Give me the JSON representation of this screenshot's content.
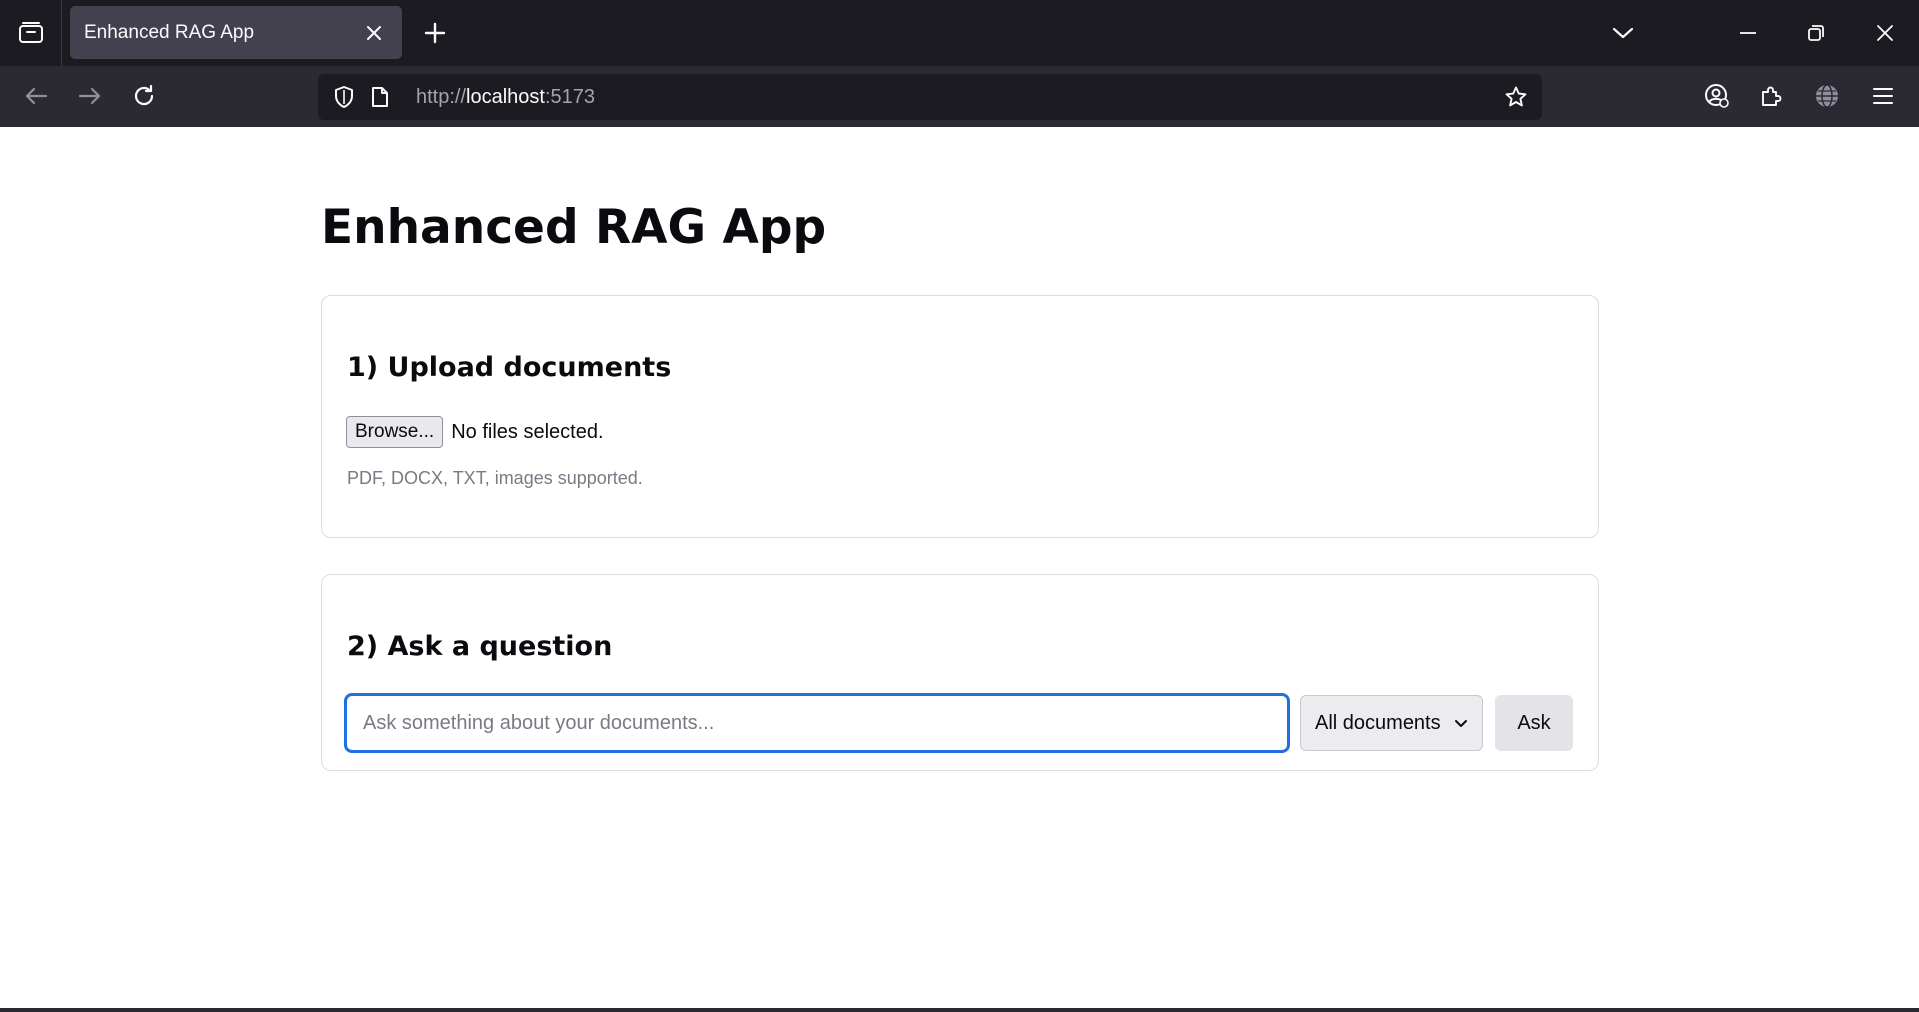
{
  "browser": {
    "tab_title": "Enhanced RAG App",
    "url_scheme": "http://",
    "url_host": "localhost",
    "url_port": ":5173",
    "icons": {
      "tab_overview": "tab-overview-icon",
      "tab_close": "close-icon",
      "new_tab": "plus-icon",
      "tab_list": "chevron-down-icon",
      "minimize": "minimize-icon",
      "restore": "restore-icon",
      "close_window": "close-icon",
      "back": "back-arrow-icon",
      "forward": "forward-arrow-icon",
      "reload": "reload-icon",
      "shield": "shield-icon",
      "page": "page-icon",
      "bookmark": "star-icon",
      "account": "account-icon",
      "extensions": "puzzle-icon",
      "translate": "globe-icon",
      "menu": "hamburger-menu-icon"
    }
  },
  "page": {
    "title": "Enhanced RAG App",
    "upload": {
      "heading": "1) Upload documents",
      "browse_label": "Browse...",
      "file_status": "No files selected.",
      "hint": "PDF, DOCX, TXT, images supported."
    },
    "ask": {
      "heading": "2) Ask a question",
      "input_value": "",
      "input_placeholder": "Ask something about your documents...",
      "scope_selected": "All documents",
      "ask_label": "Ask"
    }
  },
  "colors": {
    "input_focus": "#1f6fe5",
    "chrome_dark": "#1c1b22",
    "toolbar": "#2b2a33"
  }
}
